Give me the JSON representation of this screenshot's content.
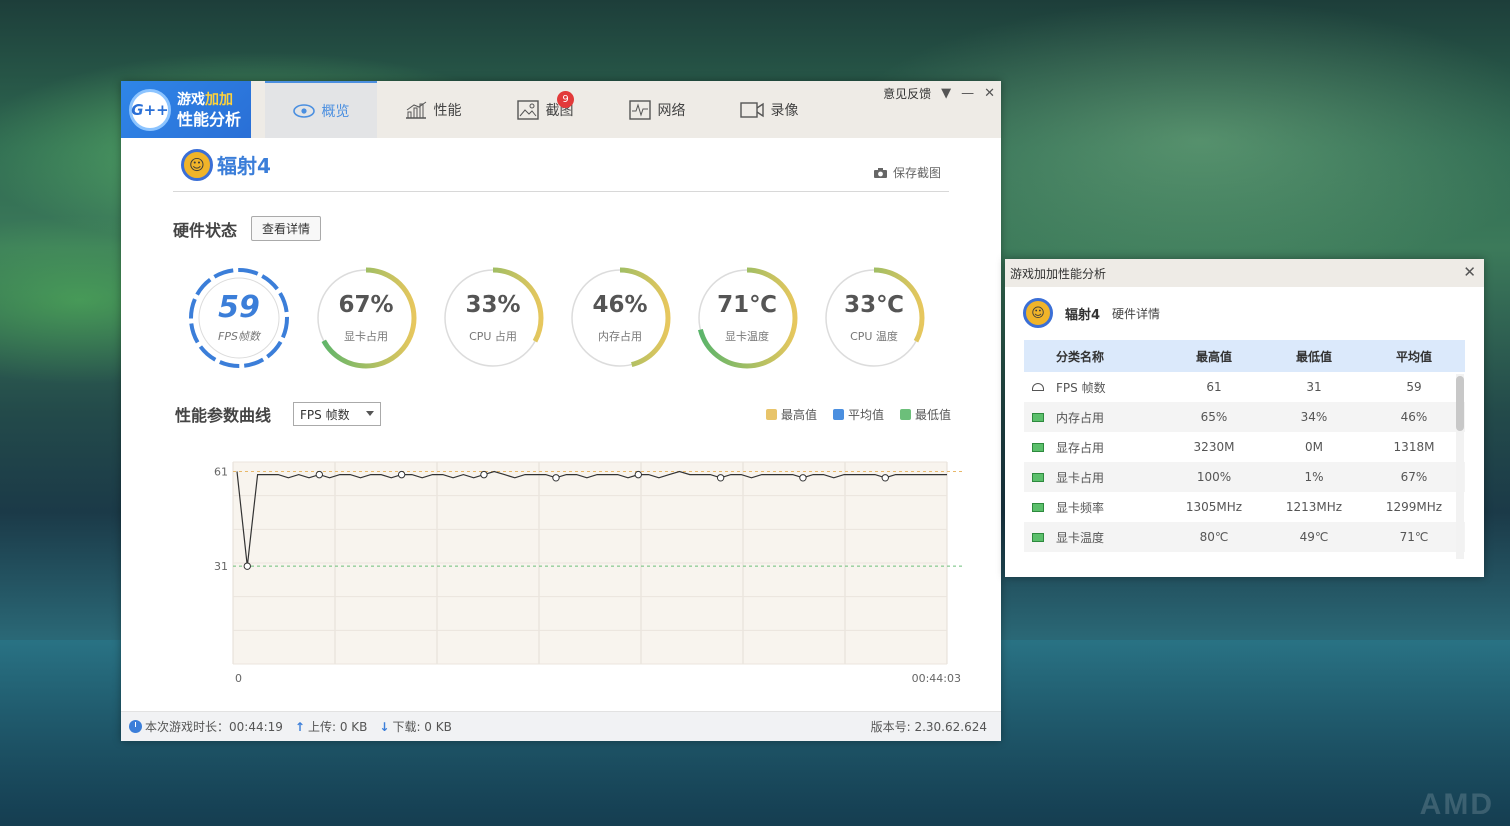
{
  "app": {
    "logo_line1_a": "游戏",
    "logo_line1_b": "加加",
    "logo_line2": "性能分析",
    "logo_badge": "G++"
  },
  "tabs": [
    {
      "label": "概览",
      "icon": "eye-icon",
      "active": true
    },
    {
      "label": "性能",
      "icon": "bar-chart-icon"
    },
    {
      "label": "截图",
      "icon": "image-icon",
      "badge": "9"
    },
    {
      "label": "网络",
      "icon": "pulse-icon"
    },
    {
      "label": "录像",
      "icon": "video-icon"
    }
  ],
  "window_controls": {
    "feedback": "意见反馈"
  },
  "game": {
    "name": "辐射4",
    "save_screenshot": "保存截图"
  },
  "hardware": {
    "title": "硬件状态",
    "detail_button": "查看详情",
    "gauges": [
      {
        "value": "59",
        "label": "FPS帧数",
        "level": 1.0
      },
      {
        "value": "67%",
        "label": "显卡占用",
        "level": 0.67
      },
      {
        "value": "33%",
        "label": "CPU 占用",
        "level": 0.33
      },
      {
        "value": "46%",
        "label": "内存占用",
        "level": 0.46
      },
      {
        "value": "71℃",
        "label": "显卡温度",
        "level": 0.71
      },
      {
        "value": "33℃",
        "label": "CPU 温度",
        "level": 0.33
      }
    ]
  },
  "perf": {
    "title": "性能参数曲线",
    "select_value": "FPS 帧数",
    "legend": [
      {
        "label": "最高值",
        "color": "#e8c46a"
      },
      {
        "label": "平均值",
        "color": "#4b8fe0"
      },
      {
        "label": "最低值",
        "color": "#6cbf7a"
      }
    ]
  },
  "chart_data": {
    "type": "line",
    "x_start_label": "0",
    "x_end_label": "00:44:03",
    "y_ticks": [
      61,
      31
    ],
    "max_line": 61,
    "min_line": 31,
    "ylim": [
      0,
      64
    ],
    "series": [
      {
        "values": [
          61,
          31,
          60,
          60,
          60,
          59,
          60,
          59,
          60,
          59,
          60,
          60,
          59,
          60,
          60,
          59,
          60,
          60,
          59,
          60,
          60,
          59,
          60,
          59,
          60,
          61,
          60,
          59,
          60,
          60,
          60,
          59,
          60,
          60,
          59,
          60,
          60,
          60,
          59,
          60,
          60,
          59,
          60,
          61,
          60,
          60,
          60,
          59,
          60,
          60,
          59,
          60,
          60,
          60,
          60,
          59,
          60,
          60,
          59,
          60,
          60,
          60,
          60,
          59,
          60,
          60,
          60,
          60,
          60,
          60
        ]
      }
    ]
  },
  "statusbar": {
    "duration": "本次游戏时长：00:44:19",
    "upload": "上传: 0 KB",
    "download": "下载: 0 KB",
    "version": "版本号: 2.30.62.624"
  },
  "side": {
    "title": "游戏加加性能分析",
    "game": "辐射4",
    "sub": "硬件详情",
    "headers": [
      "分类名称",
      "最高值",
      "最低值",
      "平均值"
    ],
    "rows": [
      {
        "name": "FPS 帧数",
        "max": "61",
        "min": "31",
        "avg": "59",
        "icon": "fps-icon"
      },
      {
        "name": "内存占用",
        "max": "65%",
        "min": "34%",
        "avg": "46%",
        "icon": "memory-icon"
      },
      {
        "name": "显存占用",
        "max": "3230M",
        "min": "0M",
        "avg": "1318M",
        "icon": "vram-icon"
      },
      {
        "name": "显卡占用",
        "max": "100%",
        "min": "1%",
        "avg": "67%",
        "icon": "gpu-icon"
      },
      {
        "name": "显卡频率",
        "max": "1305MHz",
        "min": "1213MHz",
        "avg": "1299MHz",
        "icon": "gpu-icon"
      },
      {
        "name": "显卡温度",
        "max": "80℃",
        "min": "49℃",
        "avg": "71℃",
        "icon": "gpu-icon"
      }
    ]
  },
  "desktop": {
    "watermark": "AMD"
  }
}
